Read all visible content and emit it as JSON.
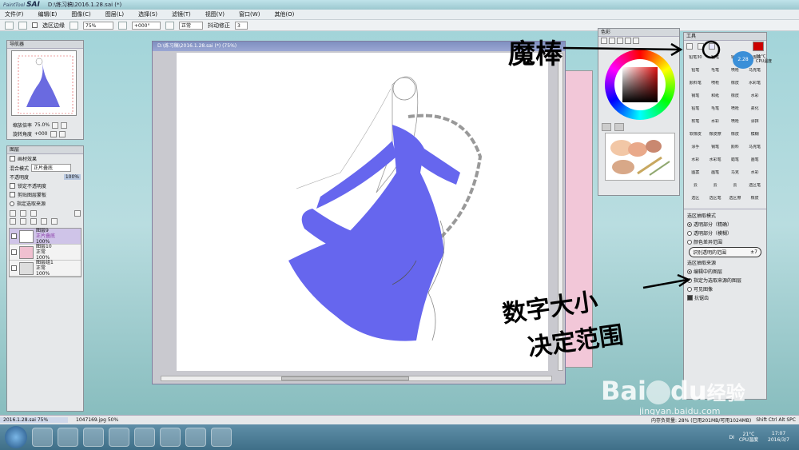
{
  "app": {
    "logo_small": "PaintTool",
    "logo": "SAI",
    "doc_title": "D:\\练习稿\\2016.1.28.sai (*)"
  },
  "menu": [
    "文件(F)",
    "编辑(E)",
    "图像(C)",
    "图层(L)",
    "选择(S)",
    "滤镜(T)",
    "视图(V)",
    "窗口(W)",
    "其他(O)"
  ],
  "toolbar": {
    "selection_edge_label": "选区边缘",
    "zoom": "75%",
    "angle": "+000°",
    "blend": "正常",
    "stabilizer_label": "抖动修正",
    "stabilizer_value": "3"
  },
  "navigator": {
    "title": "导航器",
    "zoom_label": "缩放倍率",
    "zoom_value": "75.0%",
    "rotate_label": "旋转角度",
    "rotate_value": "+000"
  },
  "layers": {
    "title": "图层",
    "effect": "画材效果",
    "mode_label": "混合模式",
    "mode_value": "正片叠底",
    "opacity_label": "不透明度",
    "opacity_value": "100%",
    "opt_lock": "锁定不透明度",
    "opt_clip": "剪贴图层蒙板",
    "opt_ref": "指定选取来源",
    "items": [
      {
        "name": "图层9",
        "mode": "正片叠底",
        "opacity": "100%"
      },
      {
        "name": "图层10",
        "mode": "正常",
        "opacity": "100%"
      },
      {
        "name": "图层组1",
        "mode": "正常",
        "opacity": "100%"
      }
    ]
  },
  "canvas": {
    "title": "D:\\练习稿\\2016.1.28.sai (*) (75%)"
  },
  "color_panel": {
    "title": "色彩"
  },
  "tool_panel": {
    "title": "工具",
    "tools": [
      "铅笔30",
      "铅笔",
      "钢笔",
      "橡皮擦",
      "铅笔",
      "毛笔",
      "喷枪",
      "马克笔",
      "颜料笔",
      "喷枪",
      "橡皮",
      "水彩笔",
      "钢笔",
      "和纸",
      "橡皮",
      "水彩",
      "铅笔",
      "毛笔",
      "喷枪",
      "柔化",
      "软笔",
      "水彩",
      "喷枪",
      "涂抹",
      "软橡皮",
      "橡皮擦",
      "橡皮",
      "模糊",
      "涂手",
      "钢笔",
      "颜料",
      "马克笔",
      "水彩",
      "水彩笔",
      "蜡笔",
      "画笔",
      "图案",
      "画笔",
      "马克",
      "水彩",
      "云",
      "云",
      "云",
      "选区笔",
      "选区",
      "选区笔",
      "选区擦",
      "橡皮"
    ],
    "magic_wand": "魔棒",
    "select_mode_title": "选区抽取模式",
    "select_modes": [
      "透明部分（精确）",
      "透明部分（模糊）",
      "颜色差异范围"
    ],
    "range_label": "识别透明的范围",
    "range_value": "±7",
    "source_title": "选区抽取来源",
    "sources": [
      "编辑中的图层",
      "指定为选取来源的图层",
      "可见图像"
    ],
    "antialias": "抗锯齿"
  },
  "statusbar": {
    "doc1": "2016.1.28.sai",
    "doc1_zoom": "75%",
    "doc2": "1047169.jpg",
    "doc2_zoom": "50%",
    "memory": "内存负荷量: 28% (已用201MB/可用1024MB)",
    "keys": "Shift Ctrl Alt SPC"
  },
  "taskbar": {
    "time": "17:07",
    "date": "2016/3/7",
    "temp": "21°C",
    "cpu": "CPU温度",
    "temp_widget": "2.28",
    "lang": "DI"
  },
  "annotations": {
    "wand": "魔棒",
    "number_size": "数字大小",
    "decide_range": "决定范围"
  },
  "watermark": {
    "brand": "Bai",
    "brand2": "du",
    "jingyan": "经验",
    "url": "jingyan.baidu.com"
  }
}
